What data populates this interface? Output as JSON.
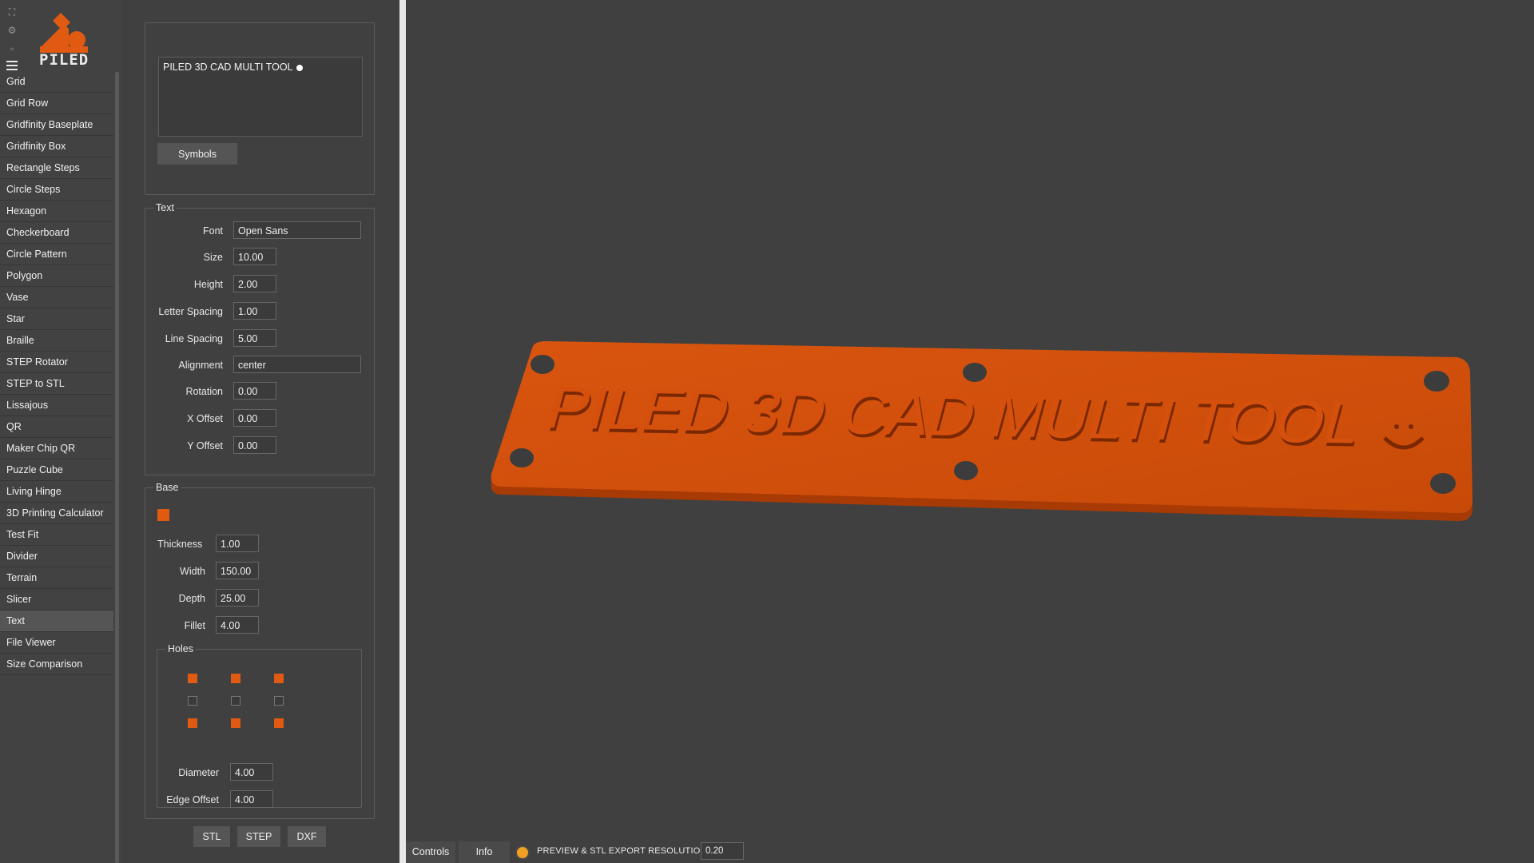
{
  "app": {
    "logo_text": "PILED",
    "accent_color": "#e05a12"
  },
  "sidebar": {
    "top_icons": [
      "fullscreen-icon",
      "settings-gear-icon",
      "small-square-icon"
    ],
    "items": [
      {
        "label": "Grid"
      },
      {
        "label": "Grid Row"
      },
      {
        "label": "Gridfinity Baseplate"
      },
      {
        "label": "Gridfinity Box"
      },
      {
        "label": "Rectangle Steps"
      },
      {
        "label": "Circle Steps"
      },
      {
        "label": "Hexagon"
      },
      {
        "label": "Checkerboard"
      },
      {
        "label": "Circle Pattern"
      },
      {
        "label": "Polygon"
      },
      {
        "label": "Vase"
      },
      {
        "label": "Star"
      },
      {
        "label": "Braille"
      },
      {
        "label": "STEP Rotator"
      },
      {
        "label": "STEP to STL"
      },
      {
        "label": "Lissajous"
      },
      {
        "label": "QR"
      },
      {
        "label": "Maker Chip QR"
      },
      {
        "label": "Puzzle Cube"
      },
      {
        "label": "Living Hinge"
      },
      {
        "label": "3D Printing Calculator"
      },
      {
        "label": "Test Fit"
      },
      {
        "label": "Divider"
      },
      {
        "label": "Terrain"
      },
      {
        "label": "Slicer"
      },
      {
        "label": "Text"
      },
      {
        "label": "File Viewer"
      },
      {
        "label": "Size Comparison"
      }
    ],
    "active_item": "Text"
  },
  "content": {
    "text_value": "PILED 3D CAD MULTI TOOL",
    "symbols_button": "Symbols"
  },
  "text_section": {
    "legend": "Text",
    "font": {
      "label": "Font",
      "value": "Open Sans"
    },
    "size": {
      "label": "Size",
      "value": "10.00"
    },
    "height": {
      "label": "Height",
      "value": "2.00"
    },
    "letter_spacing": {
      "label": "Letter Spacing",
      "value": "1.00"
    },
    "line_spacing": {
      "label": "Line Spacing",
      "value": "5.00"
    },
    "alignment": {
      "label": "Alignment",
      "value": "center"
    },
    "rotation": {
      "label": "Rotation",
      "value": "0.00"
    },
    "x_offset": {
      "label": "X Offset",
      "value": "0.00"
    },
    "y_offset": {
      "label": "Y Offset",
      "value": "0.00"
    }
  },
  "base_section": {
    "legend": "Base",
    "enabled": true,
    "thickness": {
      "label": "Thickness",
      "value": "1.00"
    },
    "width": {
      "label": "Width",
      "value": "150.00"
    },
    "depth": {
      "label": "Depth",
      "value": "25.00"
    },
    "fillet": {
      "label": "Fillet",
      "value": "4.00"
    },
    "holes": {
      "legend": "Holes",
      "grid": [
        [
          true,
          true,
          true
        ],
        [
          false,
          false,
          false
        ],
        [
          true,
          true,
          true
        ]
      ],
      "diameter": {
        "label": "Diameter",
        "value": "4.00"
      },
      "edge_offset": {
        "label": "Edge Offset",
        "value": "4.00"
      }
    }
  },
  "export": {
    "stl": "STL",
    "step": "STEP",
    "dxf": "DXF"
  },
  "bottom_bar": {
    "controls_tab": "Controls",
    "info_tab": "Info",
    "resolution_label": "PREVIEW & STL EXPORT RESOLUTION",
    "resolution_value": "0.20"
  },
  "viewport": {
    "plate_text": "PILED 3D CAD MULTI TOOL",
    "plate_symbol": "smiley",
    "plate_color": "#d4500c"
  }
}
